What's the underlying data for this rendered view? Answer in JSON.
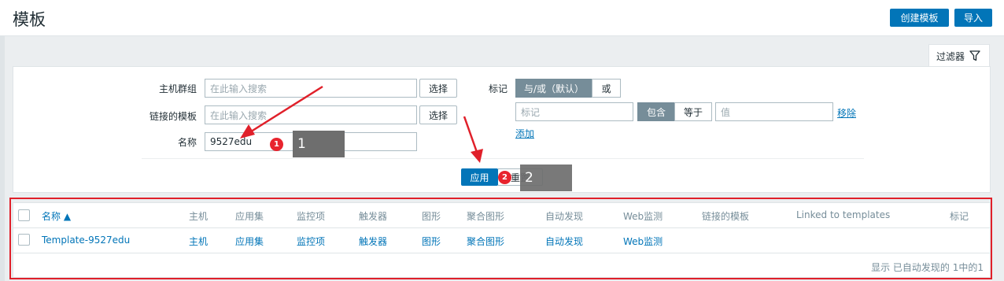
{
  "header": {
    "title": "模板",
    "create_label": "创建模板",
    "import_label": "导入"
  },
  "filter": {
    "tab_label": "过滤器",
    "host_group_label": "主机群组",
    "host_group_placeholder": "在此输入搜索",
    "linked_templates_label": "链接的模板",
    "linked_templates_placeholder": "在此输入搜索",
    "select_label": "选择",
    "name_label": "名称",
    "name_value": "9527edu",
    "tags_label": "标记",
    "and_or_label": "与/或（默认）",
    "or_label": "或",
    "tag_placeholder": "标记",
    "contains_label": "包含",
    "equals_label": "等于",
    "value_placeholder": "值",
    "remove_label": "移除",
    "add_label": "添加",
    "apply_label": "应用",
    "reset_label": "重置"
  },
  "annotations": {
    "badge1": "1",
    "badge2": "2",
    "tip1": "1",
    "tip2": "2"
  },
  "table": {
    "headers": [
      "名称 ▲",
      "主机",
      "应用集",
      "监控项",
      "触发器",
      "图形",
      "聚合图形",
      "自动发现",
      "Web监测",
      "链接的模板",
      "Linked to templates",
      "标记"
    ],
    "rows": [
      [
        "Template-9527edu",
        "主机",
        "应用集",
        "监控项",
        "触发器",
        "图形",
        "聚合图形",
        "自动发现",
        "Web监测"
      ]
    ],
    "footer": "显示 已自动发现的 1中的1"
  },
  "colors": {
    "primary": "#0275b8",
    "annotation_red": "#e0202a",
    "segment_active": "#768d99"
  }
}
